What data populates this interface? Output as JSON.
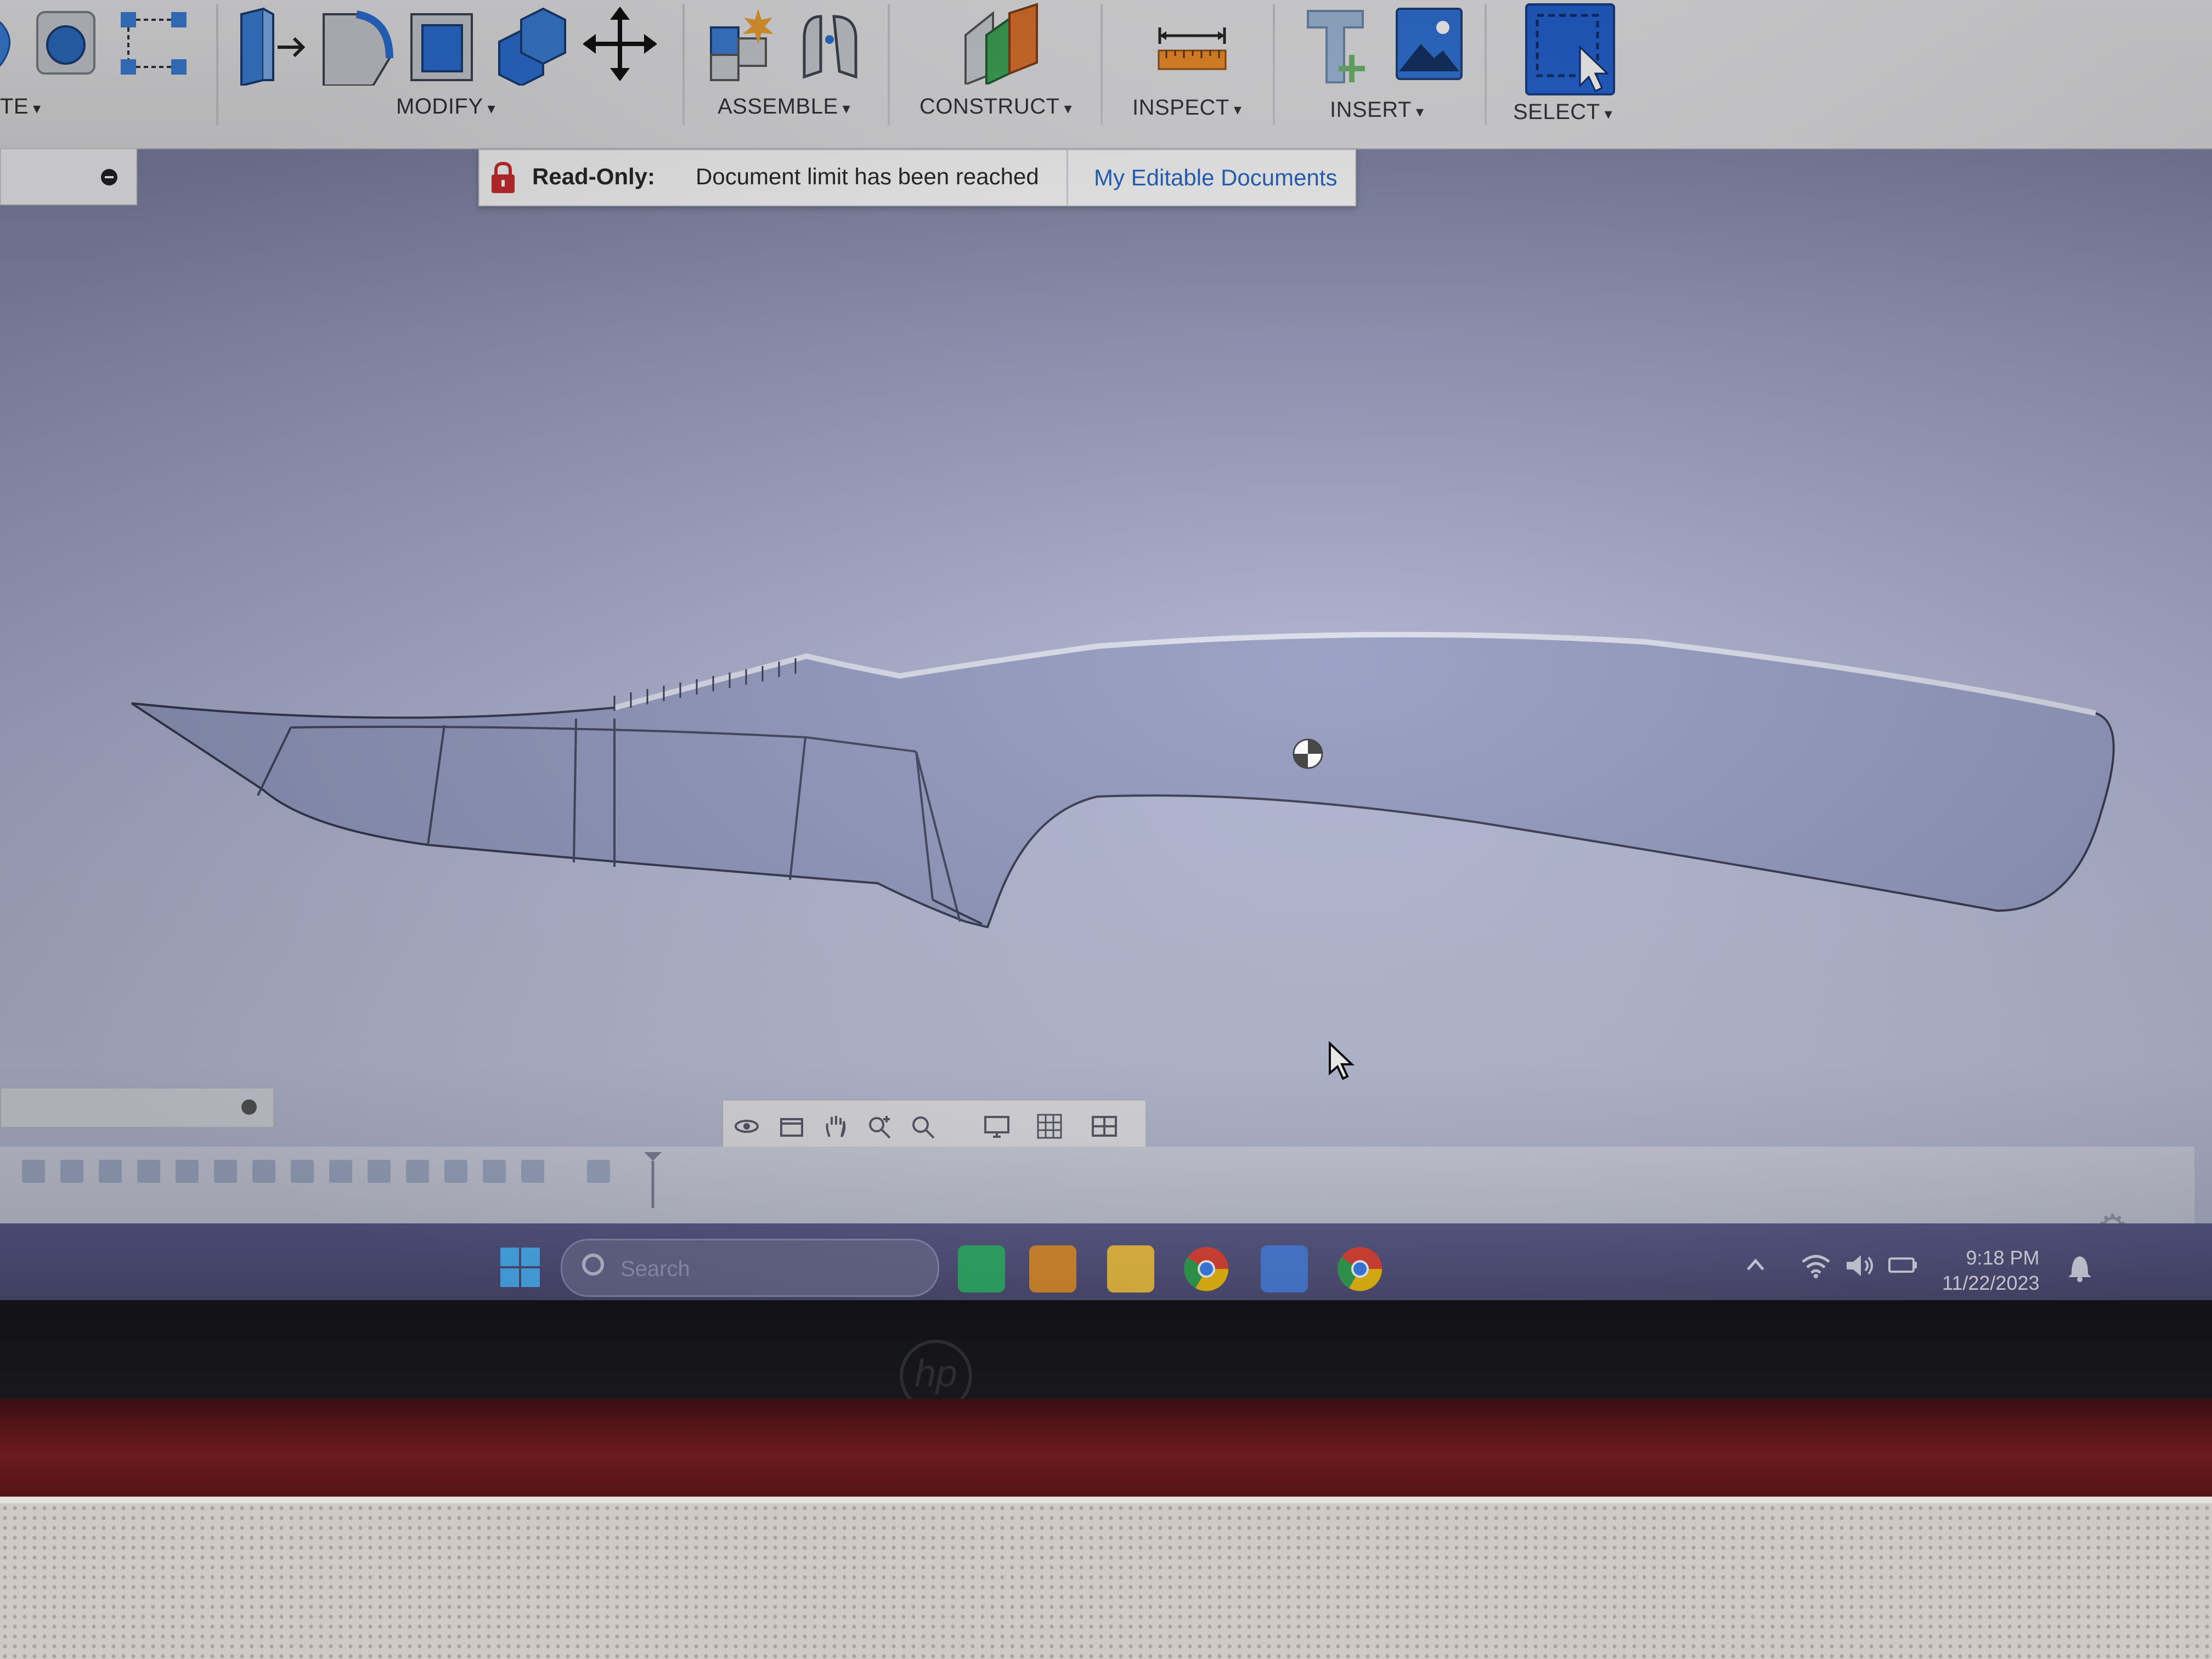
{
  "toolbar": {
    "groups": {
      "create_partial": "TE",
      "modify": "MODIFY",
      "assemble": "ASSEMBLE",
      "construct": "CONSTRUCT",
      "inspect": "INSPECT",
      "insert": "INSERT",
      "select": "SELECT"
    },
    "caret": "▾"
  },
  "banner": {
    "status_label": "Read-Only:",
    "message": "Document limit has been reached",
    "link": "My Editable Documents"
  },
  "taskbar": {
    "search_placeholder": "Search",
    "time": "9:18 PM",
    "date": "11/22/2023"
  },
  "brand": {
    "laptop_logo": "hp"
  },
  "colors": {
    "accent_blue": "#2b6fd6",
    "link_blue": "#1f5fbf",
    "lock_red": "#c8282a",
    "viewport_bg": "#a9aecd",
    "body_red": "#6b1b1e"
  }
}
